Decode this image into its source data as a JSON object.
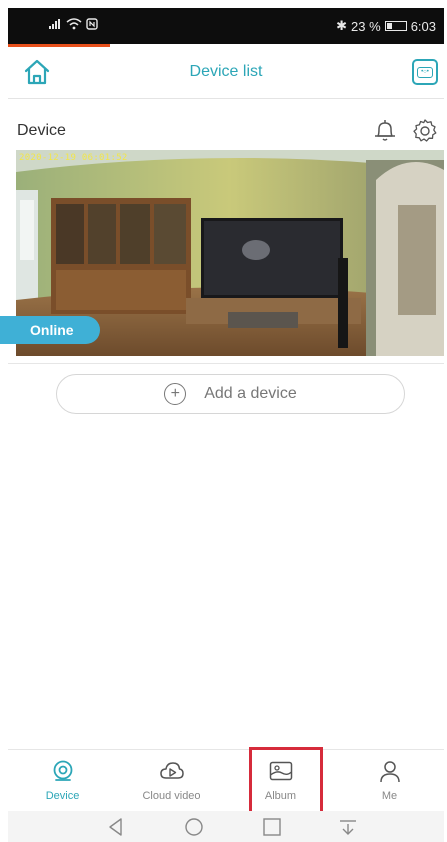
{
  "status_bar": {
    "left_icons": [
      "signal-icon",
      "wifi-icon",
      "nfc-icon"
    ],
    "bluetooth_battery": "23 %",
    "time": "6:03"
  },
  "header": {
    "title": "Device list",
    "home_icon": "home-icon",
    "right_icon": "cloud-storage-icon"
  },
  "device": {
    "name": "Device",
    "timestamp": "2020-12-19 06:01:52",
    "status": "Online"
  },
  "add_device": {
    "label": "Add a device"
  },
  "bottom_nav": {
    "items": [
      {
        "label": "Device",
        "icon": "camera-icon",
        "active": true
      },
      {
        "label": "Cloud video",
        "icon": "cloud-play-icon",
        "active": false
      },
      {
        "label": "Album",
        "icon": "album-icon",
        "active": false
      },
      {
        "label": "Me",
        "icon": "user-icon",
        "active": false
      }
    ]
  },
  "colors": {
    "accent": "#2ca6b7",
    "online_badge": "#3fb0d6",
    "highlight": "#d62b3b",
    "status_accent": "#e8501b"
  }
}
